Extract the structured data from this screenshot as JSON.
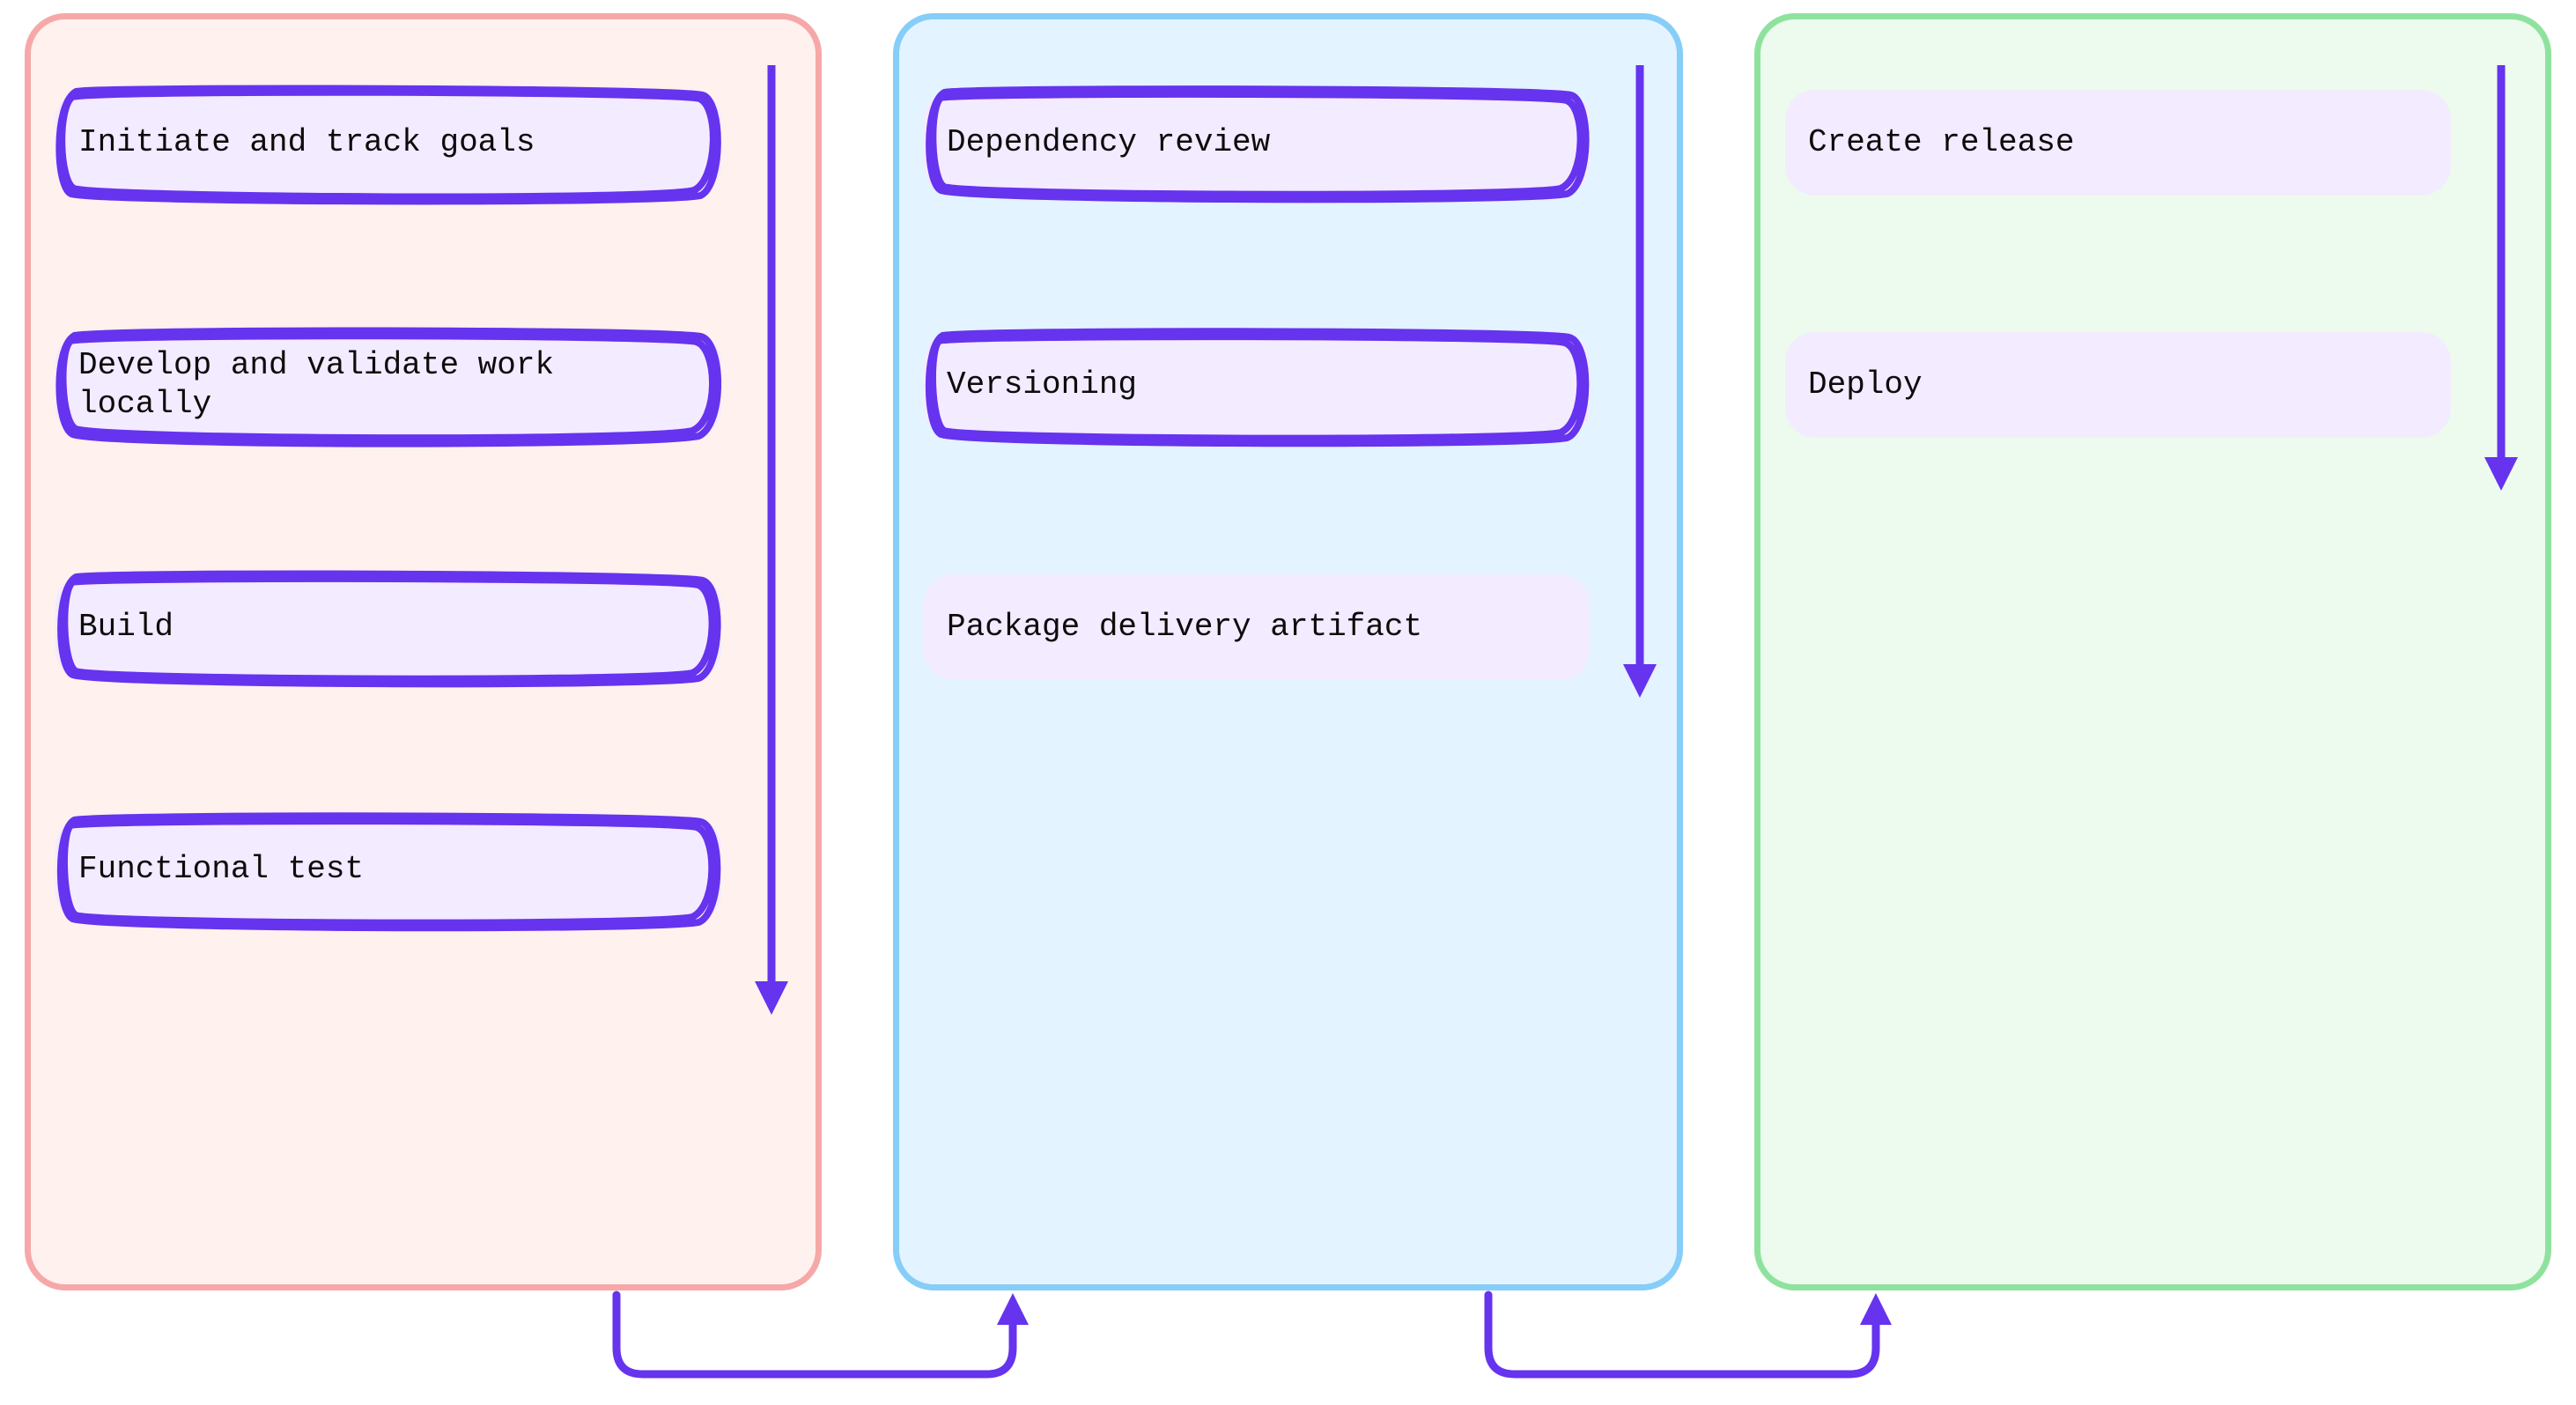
{
  "colors": {
    "outline": "#6633EE",
    "col1_bg": "#FFF1EE",
    "col1_border": "#F6A8A8",
    "col2_bg": "#E3F3FF",
    "col2_border": "#86CDF8",
    "col3_bg": "#ECFBEE",
    "col3_border": "#8FE29E",
    "step_bg": "#F3EBFF"
  },
  "columns": [
    {
      "id": "col-1",
      "steps": [
        {
          "label": "Initiate and track goals",
          "outlined": true
        },
        {
          "label": "Develop and validate work\nlocally",
          "outlined": true
        },
        {
          "label": "Build",
          "outlined": true
        },
        {
          "label": "Functional test",
          "outlined": true
        }
      ]
    },
    {
      "id": "col-2",
      "steps": [
        {
          "label": "Dependency review",
          "outlined": true
        },
        {
          "label": "Versioning",
          "outlined": true
        },
        {
          "label": "Package delivery artifact",
          "outlined": false
        }
      ]
    },
    {
      "id": "col-3",
      "steps": [
        {
          "label": "Create release",
          "outlined": false
        },
        {
          "label": "Deploy",
          "outlined": false
        }
      ]
    }
  ],
  "arrows": {
    "down_length_col1": 1060,
    "down_length_col2": 700,
    "down_length_col3": 465
  },
  "connectors": [
    {
      "from": "col-1",
      "to": "col-2"
    },
    {
      "from": "col-2",
      "to": "col-3"
    }
  ]
}
